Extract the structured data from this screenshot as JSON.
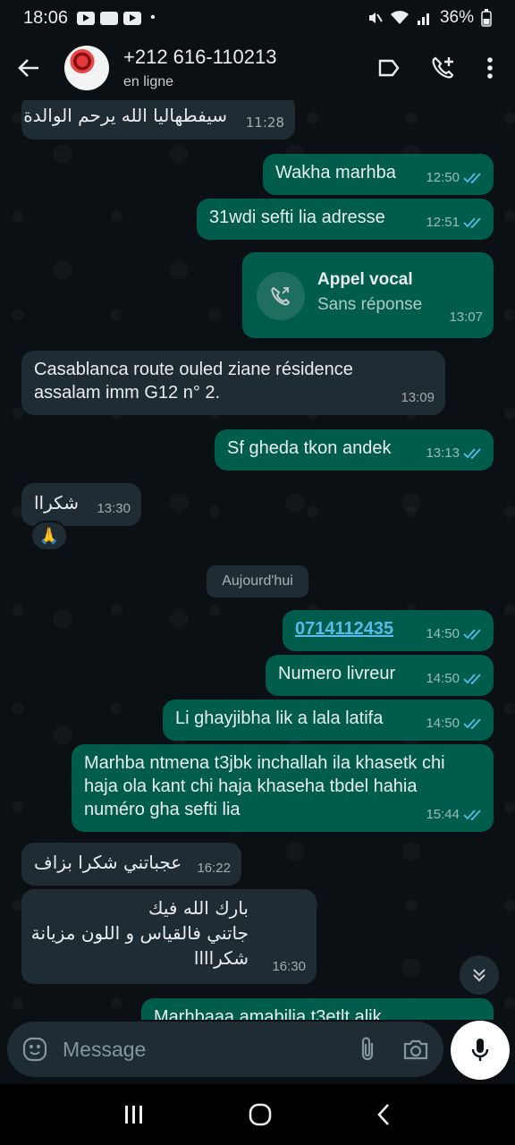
{
  "status_bar": {
    "time": "18:06",
    "battery": "36%"
  },
  "header": {
    "contact_name": "+212 616-110213",
    "presence": "en ligne"
  },
  "messages": [
    {
      "dir": "in",
      "text": "سيفطهاليا الله يرحم الوالدة",
      "time": "11:28"
    },
    {
      "dir": "out",
      "text": "Wakha marhba",
      "time": "12:50"
    },
    {
      "dir": "out",
      "text": "31wdi sefti lia adresse",
      "time": "12:51"
    },
    {
      "dir": "out",
      "call_title": "Appel vocal",
      "call_status": "Sans réponse",
      "time": "13:07"
    },
    {
      "dir": "in",
      "text": "Casablanca route ouled ziane résidence assalam imm G12 n° 2.",
      "time": "13:09"
    },
    {
      "dir": "out",
      "text": "Sf gheda tkon andek",
      "time": "13:13"
    },
    {
      "dir": "in",
      "text": "شكراا",
      "time": "13:30",
      "reaction": "🙏"
    },
    {
      "dir": "out",
      "link": "0714112435",
      "time": "14:50"
    },
    {
      "dir": "out",
      "text": "Numero livreur",
      "time": "14:50"
    },
    {
      "dir": "out",
      "text": "Li ghayjibha lik a lala latifa",
      "time": "14:50"
    },
    {
      "dir": "out",
      "text": "Marhba ntmena t3jbk inchallah ila khasetk chi haja ola kant chi haja khaseha tbdel hahia numéro gha sefti lia",
      "time": "15:44"
    },
    {
      "dir": "in",
      "text": "عجباتني شكرا بزاف",
      "time": "16:22"
    },
    {
      "dir": "in",
      "line1": "بارك الله فيك",
      "line2": "جاتني فالقياس و اللون مزيانة",
      "line3": "شكراااا",
      "time": "16:30"
    },
    {
      "dir": "out",
      "text": "Marhbaaa amabilia t3etlt alik",
      "time": ""
    }
  ],
  "date_chip": "Aujourd'hui",
  "composer": {
    "placeholder": "Message"
  }
}
